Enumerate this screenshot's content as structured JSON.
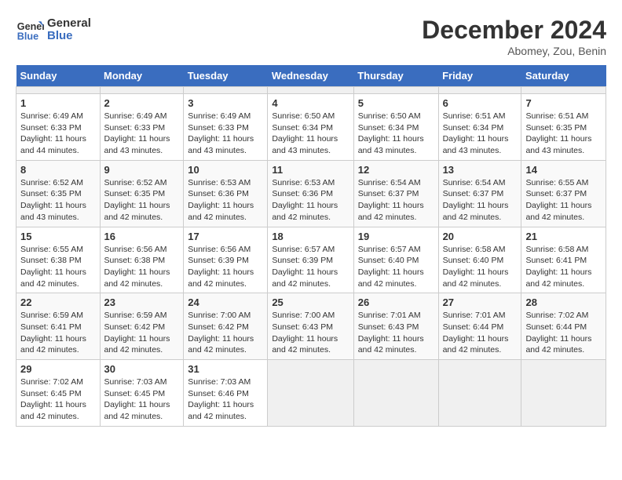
{
  "header": {
    "logo_line1": "General",
    "logo_line2": "Blue",
    "title": "December 2024",
    "subtitle": "Abomey, Zou, Benin"
  },
  "calendar": {
    "days_of_week": [
      "Sunday",
      "Monday",
      "Tuesday",
      "Wednesday",
      "Thursday",
      "Friday",
      "Saturday"
    ],
    "weeks": [
      [
        {
          "day": "",
          "info": ""
        },
        {
          "day": "",
          "info": ""
        },
        {
          "day": "",
          "info": ""
        },
        {
          "day": "",
          "info": ""
        },
        {
          "day": "",
          "info": ""
        },
        {
          "day": "",
          "info": ""
        },
        {
          "day": "",
          "info": ""
        }
      ],
      [
        {
          "day": "1",
          "sunrise": "Sunrise: 6:49 AM",
          "sunset": "Sunset: 6:33 PM",
          "daylight": "Daylight: 11 hours and 44 minutes."
        },
        {
          "day": "2",
          "sunrise": "Sunrise: 6:49 AM",
          "sunset": "Sunset: 6:33 PM",
          "daylight": "Daylight: 11 hours and 43 minutes."
        },
        {
          "day": "3",
          "sunrise": "Sunrise: 6:49 AM",
          "sunset": "Sunset: 6:33 PM",
          "daylight": "Daylight: 11 hours and 43 minutes."
        },
        {
          "day": "4",
          "sunrise": "Sunrise: 6:50 AM",
          "sunset": "Sunset: 6:34 PM",
          "daylight": "Daylight: 11 hours and 43 minutes."
        },
        {
          "day": "5",
          "sunrise": "Sunrise: 6:50 AM",
          "sunset": "Sunset: 6:34 PM",
          "daylight": "Daylight: 11 hours and 43 minutes."
        },
        {
          "day": "6",
          "sunrise": "Sunrise: 6:51 AM",
          "sunset": "Sunset: 6:34 PM",
          "daylight": "Daylight: 11 hours and 43 minutes."
        },
        {
          "day": "7",
          "sunrise": "Sunrise: 6:51 AM",
          "sunset": "Sunset: 6:35 PM",
          "daylight": "Daylight: 11 hours and 43 minutes."
        }
      ],
      [
        {
          "day": "8",
          "sunrise": "Sunrise: 6:52 AM",
          "sunset": "Sunset: 6:35 PM",
          "daylight": "Daylight: 11 hours and 43 minutes."
        },
        {
          "day": "9",
          "sunrise": "Sunrise: 6:52 AM",
          "sunset": "Sunset: 6:35 PM",
          "daylight": "Daylight: 11 hours and 42 minutes."
        },
        {
          "day": "10",
          "sunrise": "Sunrise: 6:53 AM",
          "sunset": "Sunset: 6:36 PM",
          "daylight": "Daylight: 11 hours and 42 minutes."
        },
        {
          "day": "11",
          "sunrise": "Sunrise: 6:53 AM",
          "sunset": "Sunset: 6:36 PM",
          "daylight": "Daylight: 11 hours and 42 minutes."
        },
        {
          "day": "12",
          "sunrise": "Sunrise: 6:54 AM",
          "sunset": "Sunset: 6:37 PM",
          "daylight": "Daylight: 11 hours and 42 minutes."
        },
        {
          "day": "13",
          "sunrise": "Sunrise: 6:54 AM",
          "sunset": "Sunset: 6:37 PM",
          "daylight": "Daylight: 11 hours and 42 minutes."
        },
        {
          "day": "14",
          "sunrise": "Sunrise: 6:55 AM",
          "sunset": "Sunset: 6:37 PM",
          "daylight": "Daylight: 11 hours and 42 minutes."
        }
      ],
      [
        {
          "day": "15",
          "sunrise": "Sunrise: 6:55 AM",
          "sunset": "Sunset: 6:38 PM",
          "daylight": "Daylight: 11 hours and 42 minutes."
        },
        {
          "day": "16",
          "sunrise": "Sunrise: 6:56 AM",
          "sunset": "Sunset: 6:38 PM",
          "daylight": "Daylight: 11 hours and 42 minutes."
        },
        {
          "day": "17",
          "sunrise": "Sunrise: 6:56 AM",
          "sunset": "Sunset: 6:39 PM",
          "daylight": "Daylight: 11 hours and 42 minutes."
        },
        {
          "day": "18",
          "sunrise": "Sunrise: 6:57 AM",
          "sunset": "Sunset: 6:39 PM",
          "daylight": "Daylight: 11 hours and 42 minutes."
        },
        {
          "day": "19",
          "sunrise": "Sunrise: 6:57 AM",
          "sunset": "Sunset: 6:40 PM",
          "daylight": "Daylight: 11 hours and 42 minutes."
        },
        {
          "day": "20",
          "sunrise": "Sunrise: 6:58 AM",
          "sunset": "Sunset: 6:40 PM",
          "daylight": "Daylight: 11 hours and 42 minutes."
        },
        {
          "day": "21",
          "sunrise": "Sunrise: 6:58 AM",
          "sunset": "Sunset: 6:41 PM",
          "daylight": "Daylight: 11 hours and 42 minutes."
        }
      ],
      [
        {
          "day": "22",
          "sunrise": "Sunrise: 6:59 AM",
          "sunset": "Sunset: 6:41 PM",
          "daylight": "Daylight: 11 hours and 42 minutes."
        },
        {
          "day": "23",
          "sunrise": "Sunrise: 6:59 AM",
          "sunset": "Sunset: 6:42 PM",
          "daylight": "Daylight: 11 hours and 42 minutes."
        },
        {
          "day": "24",
          "sunrise": "Sunrise: 7:00 AM",
          "sunset": "Sunset: 6:42 PM",
          "daylight": "Daylight: 11 hours and 42 minutes."
        },
        {
          "day": "25",
          "sunrise": "Sunrise: 7:00 AM",
          "sunset": "Sunset: 6:43 PM",
          "daylight": "Daylight: 11 hours and 42 minutes."
        },
        {
          "day": "26",
          "sunrise": "Sunrise: 7:01 AM",
          "sunset": "Sunset: 6:43 PM",
          "daylight": "Daylight: 11 hours and 42 minutes."
        },
        {
          "day": "27",
          "sunrise": "Sunrise: 7:01 AM",
          "sunset": "Sunset: 6:44 PM",
          "daylight": "Daylight: 11 hours and 42 minutes."
        },
        {
          "day": "28",
          "sunrise": "Sunrise: 7:02 AM",
          "sunset": "Sunset: 6:44 PM",
          "daylight": "Daylight: 11 hours and 42 minutes."
        }
      ],
      [
        {
          "day": "29",
          "sunrise": "Sunrise: 7:02 AM",
          "sunset": "Sunset: 6:45 PM",
          "daylight": "Daylight: 11 hours and 42 minutes."
        },
        {
          "day": "30",
          "sunrise": "Sunrise: 7:03 AM",
          "sunset": "Sunset: 6:45 PM",
          "daylight": "Daylight: 11 hours and 42 minutes."
        },
        {
          "day": "31",
          "sunrise": "Sunrise: 7:03 AM",
          "sunset": "Sunset: 6:46 PM",
          "daylight": "Daylight: 11 hours and 42 minutes."
        },
        {
          "day": "",
          "info": ""
        },
        {
          "day": "",
          "info": ""
        },
        {
          "day": "",
          "info": ""
        },
        {
          "day": "",
          "info": ""
        }
      ]
    ]
  }
}
